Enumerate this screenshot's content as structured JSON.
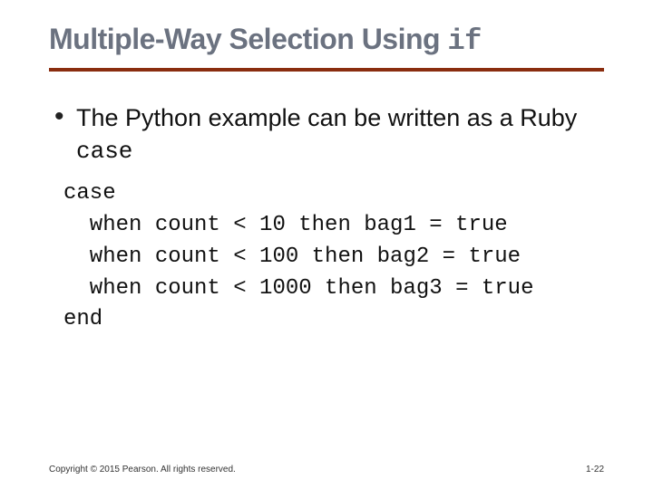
{
  "title": {
    "prefix": "Multiple-Way Selection Using ",
    "code": "if"
  },
  "bullet": {
    "prefix": "The Python example can be written as a Ruby ",
    "code": "case"
  },
  "code_block": "case\n  when count < 10 then bag1 = true\n  when count < 100 then bag2 = true\n  when count < 1000 then bag3 = true\nend",
  "footer": {
    "copyright": "Copyright © 2015 Pearson. All rights reserved.",
    "page": "1-22"
  }
}
